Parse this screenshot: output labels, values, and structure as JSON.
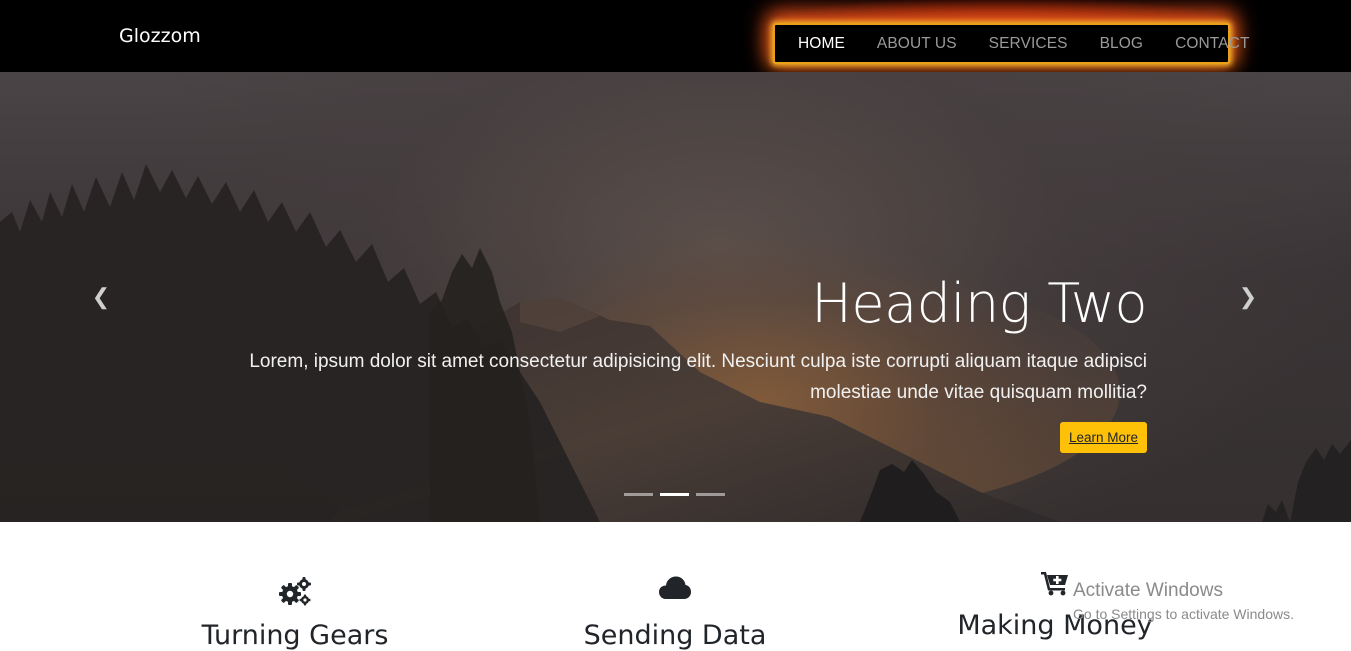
{
  "navbar": {
    "brand": "Glozzom",
    "links": [
      {
        "label": "HOME",
        "active": true
      },
      {
        "label": "ABOUT US",
        "active": false
      },
      {
        "label": "SERVICES",
        "active": false
      },
      {
        "label": "BLOG",
        "active": false
      },
      {
        "label": "CONTACT",
        "active": false
      }
    ]
  },
  "hero": {
    "heading": "Heading Two",
    "text": "Lorem, ipsum dolor sit amet consectetur adipisicing elit. Nesciunt culpa iste corrupti aliquam itaque adipisci molestiae unde vitae quisquam mollitia?",
    "button_label": "Learn More",
    "prev_icon": "chevron-left-icon",
    "next_icon": "chevron-right-icon",
    "slide_count": 3,
    "active_slide": 2
  },
  "features": [
    {
      "icon": "gears-icon",
      "title": "Turning Gears"
    },
    {
      "icon": "cloud-icon",
      "title": "Sending Data"
    },
    {
      "icon": "cart-plus-icon",
      "title": "Making Money"
    }
  ],
  "watermark": {
    "line1": "Activate Windows",
    "line2": "Go to Settings to activate Windows."
  },
  "colors": {
    "navbar_bg": "#000000",
    "accent_button": "#ffc107",
    "nav_glow": "#e8a21a"
  }
}
